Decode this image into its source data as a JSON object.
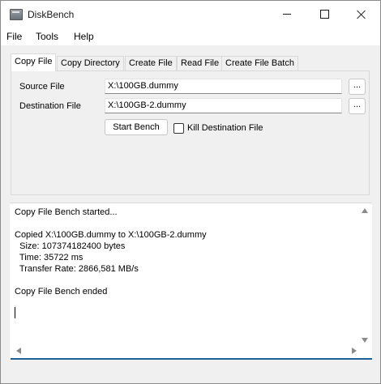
{
  "window": {
    "title": "DiskBench",
    "icon": "disk-drive-icon"
  },
  "menu": {
    "items": [
      "File",
      "Tools",
      "Help"
    ]
  },
  "tabs": {
    "items": [
      "Copy File",
      "Copy Directory",
      "Create File",
      "Read File",
      "Create File Batch"
    ],
    "active": "Copy File"
  },
  "copy_file": {
    "source_label": "Source File",
    "source_value": "X:\\100GB.dummy",
    "dest_label": "Destination File",
    "dest_value": "X:\\100GB-2.dummy",
    "browse_label": "...",
    "start_label": "Start Bench",
    "kill_label": "Kill Destination File",
    "kill_checked": false
  },
  "log": {
    "lines": [
      "Copy File Bench started...",
      "",
      "Copied X:\\100GB.dummy to X:\\100GB-2.dummy",
      "  Size: 107374182400 bytes",
      "  Time: 35722 ms",
      "  Transfer Rate: 2866,581 MB/s",
      "",
      "Copy File Bench ended"
    ]
  },
  "colors": {
    "progress": "#1e5f96",
    "window_bg": "#f0f0f0"
  }
}
